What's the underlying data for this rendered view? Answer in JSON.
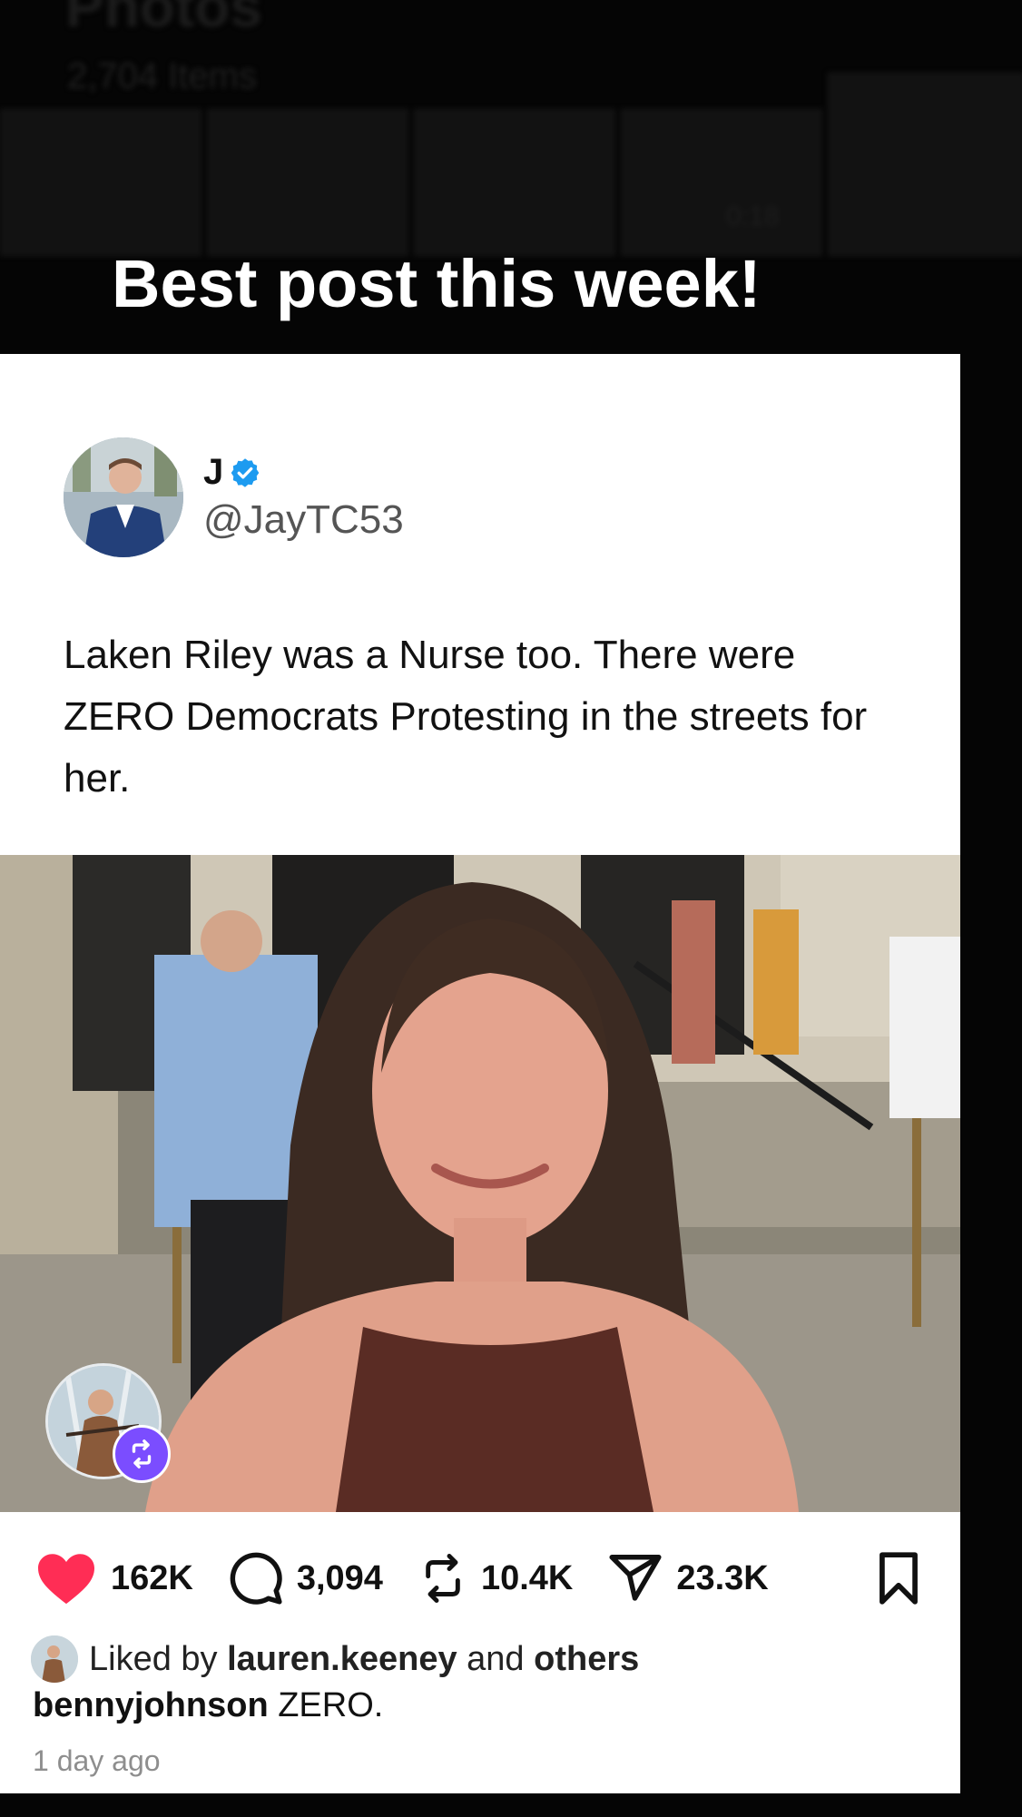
{
  "background": {
    "app_title": "Photos",
    "item_count": "2,704 Items",
    "video_duration": "0:18"
  },
  "headline": "Best post this week!",
  "tweet": {
    "display_name": "J",
    "handle": "@JayTC53",
    "verified": true,
    "text": "Laken Riley was a Nurse too. There were ZERO Democrats Protesting in the streets for her."
  },
  "actions": {
    "likes": "162K",
    "comments": "3,094",
    "reposts": "10.4K",
    "shares": "23.3K"
  },
  "liked_by": {
    "prefix": "Liked by",
    "user": "lauren.keeney",
    "conjunction": "and",
    "others": "others"
  },
  "caption": {
    "username": "bennyjohnson",
    "text": "ZERO."
  },
  "timestamp": "1 day ago",
  "colors": {
    "heart": "#ff2d55",
    "verified": "#1d9bf0",
    "repost_badge": "#7b4dff"
  }
}
